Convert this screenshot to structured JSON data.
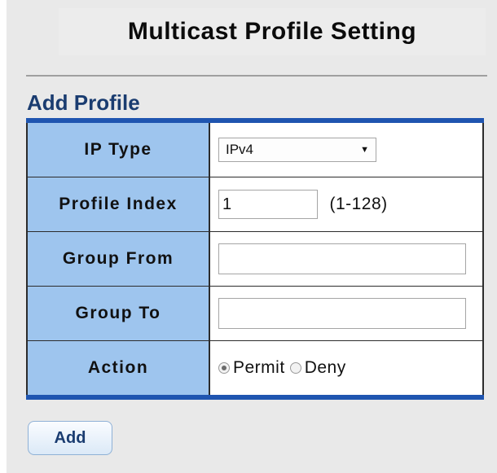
{
  "header": {
    "title": "Multicast Profile Setting"
  },
  "section": {
    "title": "Add Profile"
  },
  "form": {
    "ip_type": {
      "label": "IP Type",
      "selected": "IPv4",
      "arrow_icon": "dropdown-arrow-icon"
    },
    "profile_index": {
      "label": "Profile Index",
      "value": "1",
      "hint": "(1-128)"
    },
    "group_from": {
      "label": "Group From",
      "value": ""
    },
    "group_to": {
      "label": "Group To",
      "value": ""
    },
    "action": {
      "label": "Action",
      "options": [
        "Permit",
        "Deny"
      ],
      "selected": "Permit"
    }
  },
  "buttons": {
    "add_label": "Add"
  },
  "colors": {
    "label_cell_bg": "#9ec5ee",
    "table_border_accent": "#1f55b0",
    "section_title": "#1a3c70",
    "page_bg": "#e9e9e9"
  }
}
